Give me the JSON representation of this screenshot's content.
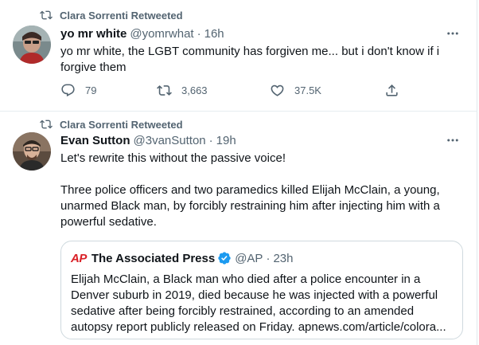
{
  "colors": {
    "secondary_text": "#536471",
    "primary_text": "#0f1419",
    "divider": "#e6ecf0",
    "verified_blue": "#1d9bf0",
    "ap_red": "#d91f26"
  },
  "tweets": [
    {
      "retweet_label": "Clara Sorrenti Retweeted",
      "author_name": "yo mr white",
      "handle": "@yomrwhat",
      "dot": "·",
      "time": "16h",
      "text": "yo mr white, the LGBT community has forgiven me... but i don't know if i forgive them",
      "actions": {
        "replies": "79",
        "retweets": "3,663",
        "likes": "37.5K"
      },
      "icons": {
        "retweet": "retweet-icon",
        "more": "more-icon",
        "reply": "reply-icon",
        "like": "heart-icon",
        "share": "share-icon"
      }
    },
    {
      "retweet_label": "Clara Sorrenti Retweeted",
      "author_name": "Evan Sutton",
      "handle": "@3vanSutton",
      "dot": "·",
      "time": "19h",
      "text_line1": "Let's rewrite this without the passive voice!",
      "text_para2": "Three police officers and two paramedics killed Elijah McClain, a young, unarmed Black man, by forcibly restraining him after injecting him with a powerful sedative.",
      "quote": {
        "logo": "AP",
        "name": "The Associated Press",
        "handle": "@AP",
        "dot": "·",
        "time": "23h",
        "text": "Elijah McClain, a Black man who died after a police encounter in a Denver suburb in 2019, died because he was injected with a powerful sedative after being forcibly restrained, according to an amended autopsy report publicly released on Friday. apnews.com/article/colora..."
      }
    }
  ]
}
